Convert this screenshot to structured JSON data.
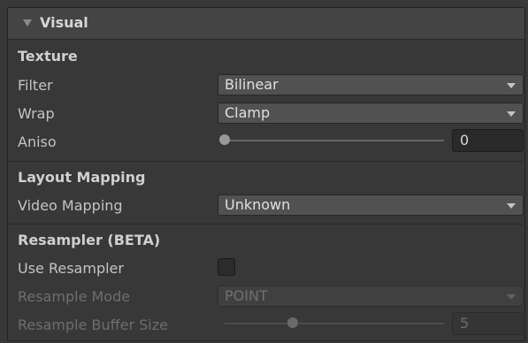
{
  "panel": {
    "title": "Visual",
    "collapsed": false
  },
  "texture": {
    "section": "Texture",
    "filter": {
      "label": "Filter",
      "value": "Bilinear"
    },
    "wrap": {
      "label": "Wrap",
      "value": "Clamp"
    },
    "aniso": {
      "label": "Aniso",
      "value": "0",
      "level": 0
    }
  },
  "layout_mapping": {
    "section": "Layout Mapping",
    "video_mapping": {
      "label": "Video Mapping",
      "value": "Unknown"
    }
  },
  "resampler": {
    "section": "Resampler (BETA)",
    "use_resampler": {
      "label": "Use Resampler",
      "checked": false
    },
    "resample_mode": {
      "label": "Resample Mode",
      "value": "POINT",
      "enabled": false
    },
    "buffer_size": {
      "label": "Resample Buffer Size",
      "value": "5",
      "level": 0.31,
      "enabled": false
    }
  },
  "colors": {
    "background": "#383838",
    "header": "#444444",
    "field": "#515151"
  }
}
